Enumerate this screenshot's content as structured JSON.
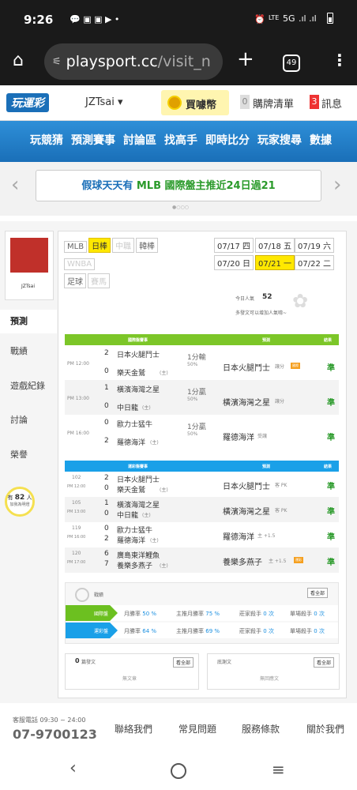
{
  "status": {
    "time": "9:26",
    "signal": "5G"
  },
  "browser": {
    "url_host": "playsport.cc",
    "url_path": "/visit_n",
    "tab_count": "49"
  },
  "site": {
    "logo": "玩運彩",
    "user": "JZTsai ▾",
    "buy": "買噱幣",
    "cart_count": "0",
    "cart": "購牌清單",
    "msg_count": "3",
    "msg": "訊息"
  },
  "nav": [
    "玩競猜",
    "預測賽事",
    "討論區",
    "找高手",
    "即時比分",
    "玩家搜尋",
    "數據"
  ],
  "banner": {
    "prefix": "假球天天有 ",
    "accent": "MLB 國際盤主推近24日過21"
  },
  "profile": {
    "name": "JZTsai"
  },
  "sidebar": [
    "預測",
    "戰績",
    "遊戲紀錄",
    "討論",
    "榮譽"
  ],
  "like": {
    "prefix": "有",
    "count": "82",
    "suffix": "人",
    "line2": "加我為明燈"
  },
  "leagues": {
    "row1": [
      "MLB",
      "日棒",
      "中職",
      "韓棒"
    ],
    "row2": [
      "WNBA"
    ],
    "row3": [
      "足球",
      "賽馬"
    ]
  },
  "dates": [
    "07/17 四",
    "07/18 五",
    "07/19 六",
    "07/20 日",
    "07/21 一",
    "07/22 二"
  ],
  "popularity": {
    "label": "今日人氣",
    "count": "52",
    "note": "多發文可以增加人氣唷~"
  },
  "intl": {
    "header": [
      "國際盤賽事",
      "預測",
      "結果"
    ],
    "rows": [
      {
        "time": "PM 12:00",
        "s1": "2",
        "t1": "日本火腿鬥士",
        "s2": "0",
        "t2": "樂天金鷲",
        "h1": "(主)",
        "line": "1分輸",
        "pct": "50%",
        "pick": "日本火腿鬥士",
        "pick_note": "讓分",
        "badge": "國際",
        "result": "準"
      },
      {
        "time": "PM 13:00",
        "s1": "1",
        "t1": "橫濱海灣之星",
        "s2": "0",
        "t2": "中日龍",
        "h1": "(主)",
        "line": "1分贏",
        "pct": "50%",
        "pick": "橫濱海灣之星",
        "pick_note": "讓分",
        "badge": "",
        "result": "準"
      },
      {
        "time": "PM 16:00",
        "s1": "0",
        "t1": "歐力士猛牛",
        "s2": "2",
        "t2": "羅德海洋",
        "h1": "(主)",
        "line": "1分贏",
        "pct": "50%",
        "pick": "羅德海洋",
        "pick_note": "受讓",
        "badge": "",
        "result": "準"
      }
    ]
  },
  "local": {
    "header": [
      "運彩盤賽事",
      "預測",
      "結果"
    ],
    "rows": [
      {
        "no": "102",
        "time": "PM 12:00",
        "s1": "2",
        "t1": "日本火腿鬥士",
        "s2": "0",
        "t2": "樂天金鷲",
        "h1": "(主)",
        "pick": "日本火腿鬥士",
        "pick_note": "客 PK",
        "badge": "",
        "result": "準"
      },
      {
        "no": "105",
        "time": "PM 13:00",
        "s1": "1",
        "t1": "橫濱海灣之星",
        "s2": "0",
        "t2": "中日龍",
        "h1": "(主)",
        "pick": "橫濱海灣之星",
        "pick_note": "客 PK",
        "badge": "",
        "result": "準"
      },
      {
        "no": "119",
        "time": "PM 16:00",
        "s1": "0",
        "t1": "歐力士猛牛",
        "s2": "2",
        "t2": "羅德海洋",
        "h1": "(主)",
        "pick": "羅德海洋",
        "pick_note": "主 +1.5",
        "badge": "",
        "result": "準"
      },
      {
        "no": "120",
        "time": "PM 17:00",
        "s1": "6",
        "t1": "廣島東洋鯉魚",
        "s2": "7",
        "t2": "養樂多燕子",
        "h1": "(主)",
        "pick": "養樂多燕子",
        "pick_note": "主 +1.5",
        "badge": "運彩",
        "result": "準"
      }
    ]
  },
  "record": {
    "title": "戰績",
    "see_all": "看全部",
    "rows": [
      {
        "label": "國際盤",
        "month": "月勝率",
        "m_val": "50",
        "main": "主推月勝率",
        "main_val": "75",
        "wang": "莊家殺手",
        "wang_val": "0",
        "single": "單場殺手",
        "single_val": "0",
        "color": "#6cc020"
      },
      {
        "label": "運彩盤",
        "month": "月勝率",
        "m_val": "64",
        "main": "主推月勝率",
        "main_val": "69",
        "wang": "莊家殺手",
        "wang_val": "0",
        "single": "單場殺手",
        "single_val": "0",
        "color": "#1aa0e8"
      }
    ],
    "pct": "%",
    "unit": "次"
  },
  "posts": {
    "count": "0",
    "label": "篇發文",
    "see_all": "看全部",
    "empty": "無文章"
  },
  "replies": {
    "label": "底謝文",
    "see_all": "看全部",
    "empty": "無回應文"
  },
  "footer": {
    "service": "客服電話 09:30 ~ 24:00",
    "phone": "07-9700123",
    "links": [
      "聯絡我們",
      "常見問題",
      "服務條款",
      "關於我們"
    ]
  }
}
